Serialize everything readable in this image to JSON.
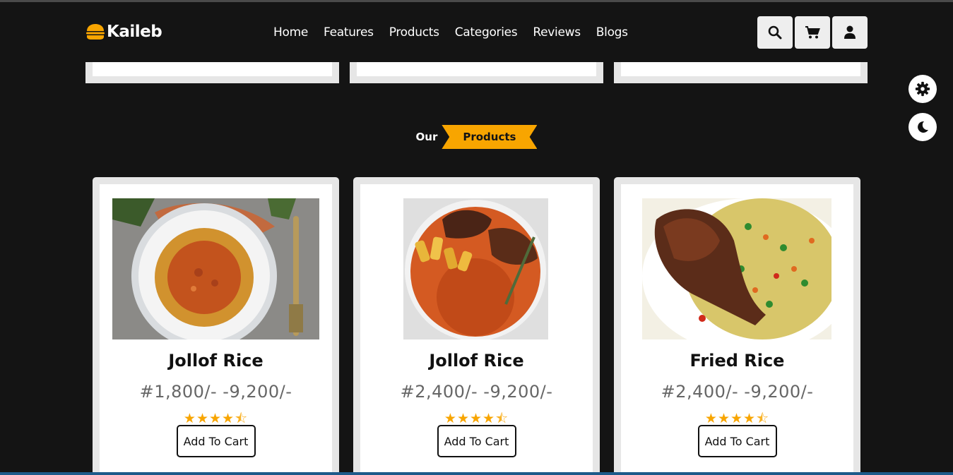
{
  "brand": {
    "name": "Kaileb"
  },
  "nav": {
    "items": [
      {
        "label": "Home"
      },
      {
        "label": "Features"
      },
      {
        "label": "Products"
      },
      {
        "label": "Categories"
      },
      {
        "label": "Reviews"
      },
      {
        "label": "Blogs"
      }
    ]
  },
  "header_icons": [
    "search-icon",
    "cart-icon",
    "user-icon"
  ],
  "side_icons": [
    "gear-icon",
    "moon-icon"
  ],
  "section": {
    "prefix": "Our",
    "title": "Products"
  },
  "products": [
    {
      "name": "Jollof Rice",
      "price": "#1,800/- -9,200/-",
      "rating": 4.5,
      "button": "Add To Cart"
    },
    {
      "name": "Jollof Rice",
      "price": "#2,400/- -9,200/-",
      "rating": 4.5,
      "button": "Add To Cart"
    },
    {
      "name": "Fried Rice",
      "price": "#2,400/- -9,200/-",
      "rating": 4.5,
      "button": "Add To Cart"
    }
  ],
  "colors": {
    "background": "#141414",
    "accent": "#f8a500",
    "card": "#e6e6e6"
  }
}
